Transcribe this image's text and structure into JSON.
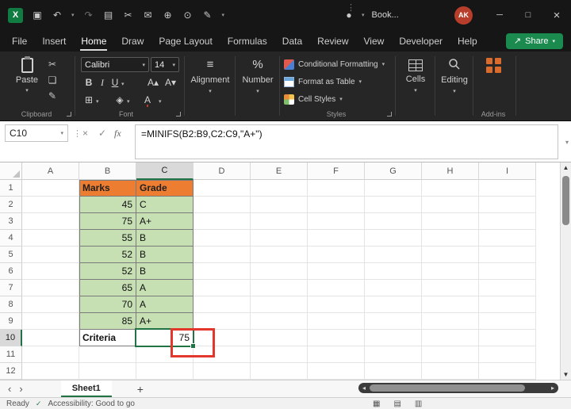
{
  "titlebar": {
    "doc_name": "Book...",
    "avatar": "AK"
  },
  "menubar": {
    "items": [
      "File",
      "Insert",
      "Home",
      "Draw",
      "Page Layout",
      "Formulas",
      "Data",
      "Review",
      "View",
      "Developer",
      "Help"
    ],
    "active": "Home",
    "share": "Share"
  },
  "ribbon": {
    "paste_label": "Paste",
    "clipboard_label": "Clipboard",
    "font_name": "Calibri",
    "font_size": "14",
    "bold": "B",
    "italic": "I",
    "underline": "U",
    "grow_font": "A▴",
    "shrink_font": "A▾",
    "borders": "⊞",
    "fill": "◈",
    "font_color": "A",
    "font_label": "Font",
    "align": "≡",
    "alignment_label": "Alignment",
    "percent": "%",
    "number_label": "Number",
    "conditional_formatting_label": "Conditional Formatting",
    "format_as_table_label": "Format as Table",
    "cell_styles_label": "Cell Styles",
    "styles_label": "Styles",
    "cells_label": "Cells",
    "editing_label": "Editing",
    "addins_label": "Add-ins"
  },
  "formula_bar": {
    "name_box": "C10",
    "fx": "fx",
    "formula": "=MINIFS(B2:B9,C2:C9,\"A+\")"
  },
  "grid": {
    "columns": [
      "A",
      "B",
      "C",
      "D",
      "E",
      "F",
      "G",
      "H",
      "I"
    ],
    "row_numbers": [
      "1",
      "2",
      "3",
      "4",
      "5",
      "6",
      "7",
      "8",
      "9",
      "10",
      "11",
      "12"
    ],
    "selected_column": "C",
    "selected_row": "10",
    "active_cell": "C10",
    "header_marks": "Marks",
    "header_grade": "Grade",
    "data_rows": [
      {
        "marks": "45",
        "grade": "C"
      },
      {
        "marks": "75",
        "grade": "A+"
      },
      {
        "marks": "55",
        "grade": "B"
      },
      {
        "marks": "52",
        "grade": "B"
      },
      {
        "marks": "52",
        "grade": "B"
      },
      {
        "marks": "65",
        "grade": "A"
      },
      {
        "marks": "70",
        "grade": "A"
      },
      {
        "marks": "85",
        "grade": "A+"
      }
    ],
    "criteria_label": "Criteria",
    "criteria_value": "75"
  },
  "sheetbar": {
    "tabs": [
      "Sheet1"
    ],
    "active": "Sheet1"
  },
  "statusbar": {
    "ready": "Ready",
    "accessibility": "Accessibility: Good to go"
  },
  "colors": {
    "accent_green": "#217346",
    "share_green": "#1A8A4F",
    "header_orange": "#ED7D31",
    "data_green": "#C6E0B4",
    "annotation_red": "#E3372C",
    "addins_orange": "#D96C2C"
  },
  "icons": {
    "logo": "X",
    "save": "▣",
    "undo": "↶",
    "redo": "↷",
    "book": "▤",
    "cut": "✂",
    "copy": "❏",
    "mail": "✉",
    "pin": "⊕",
    "camera": "⊙",
    "pen": "✎",
    "record": "●",
    "chevron": "▾",
    "minimize": "─",
    "maximize": "□",
    "close": "×",
    "share_arrow": "↗",
    "cancel": "×",
    "enter": "✓",
    "dots": "⋮",
    "prev": "‹",
    "next": "›",
    "plus": "+",
    "up": "▲",
    "down": "▼",
    "left": "◂",
    "right": "▸",
    "check": "✓",
    "view_normal": "▦",
    "view_layout": "▤",
    "view_break": "▥"
  }
}
